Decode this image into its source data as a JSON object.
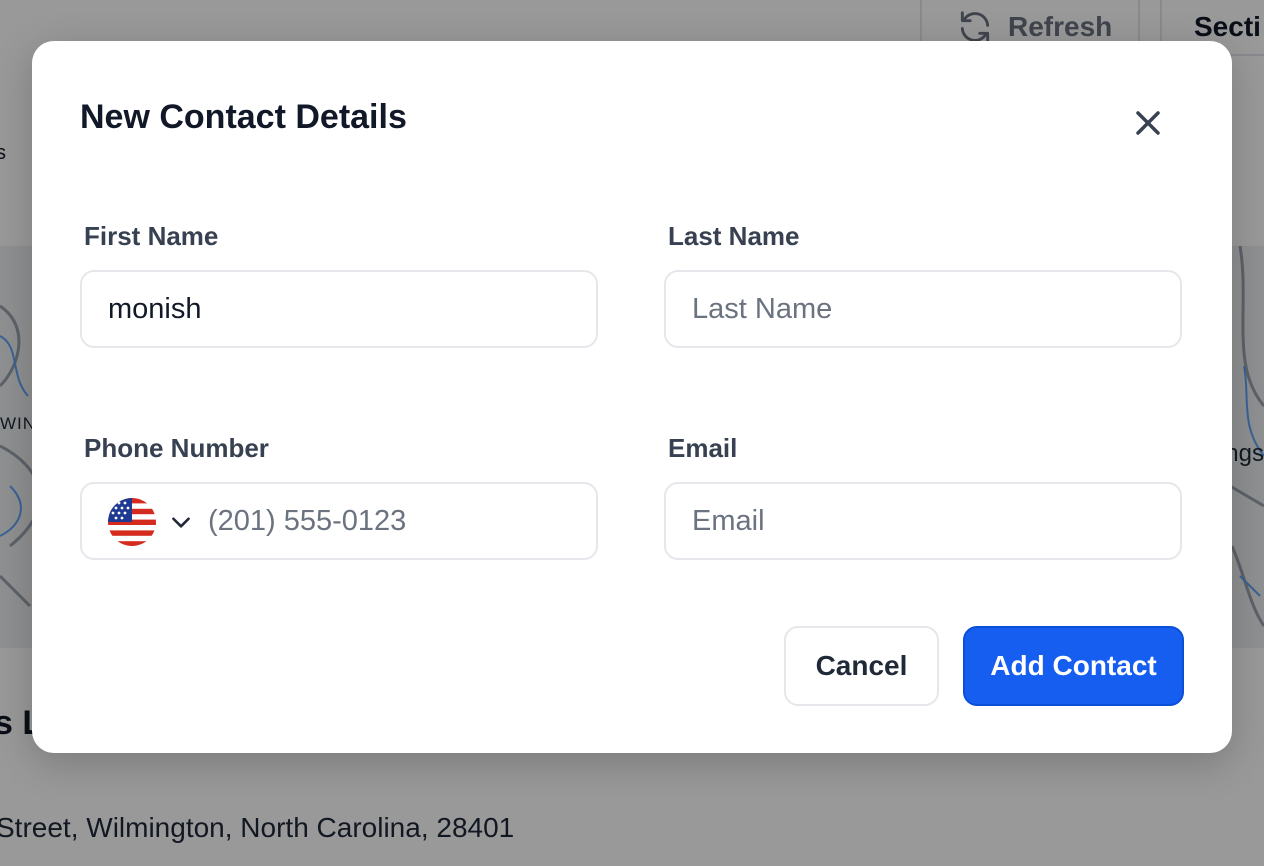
{
  "background": {
    "toolbar": {
      "refresh_label": "Refresh",
      "section_label": "Secti"
    },
    "edge_text_top": "s",
    "map": {
      "label_left": "WIN",
      "label_right": "ngs"
    },
    "heading_fragment": "s L",
    "address_fragment": "Street, Wilmington, North Carolina, 28401"
  },
  "modal": {
    "title": "New Contact Details",
    "close_icon": "close-icon",
    "fields": {
      "first_name": {
        "label": "First Name",
        "value": "monish",
        "placeholder": "First Name"
      },
      "last_name": {
        "label": "Last Name",
        "value": "",
        "placeholder": "Last Name"
      },
      "phone": {
        "label": "Phone Number",
        "value": "",
        "placeholder": "(201) 555-0123",
        "country_icon": "us-flag-icon"
      },
      "email": {
        "label": "Email",
        "value": "",
        "placeholder": "Email"
      }
    },
    "buttons": {
      "cancel": "Cancel",
      "add": "Add Contact"
    }
  },
  "colors": {
    "primary": "#155eef",
    "overlay": "rgba(0,0,0,0.40)"
  }
}
